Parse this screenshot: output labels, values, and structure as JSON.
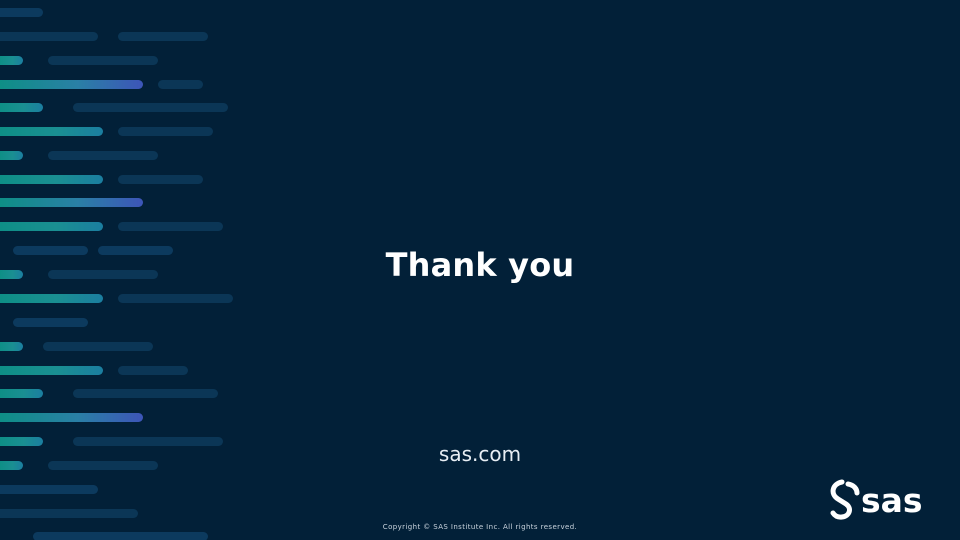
{
  "slide": {
    "title": "Thank you",
    "website": "sas.com",
    "copyright": "Copyright © SAS Institute Inc. All rights reserved.",
    "logo": {
      "icon": "sas-logo-icon",
      "wordmark": "sas"
    }
  },
  "colors": {
    "background": "#022038",
    "teal_accent": "#0e8f86",
    "blue_accent": "#3d55b8",
    "dark_stripe": "#0b3656",
    "text": "#ffffff"
  }
}
